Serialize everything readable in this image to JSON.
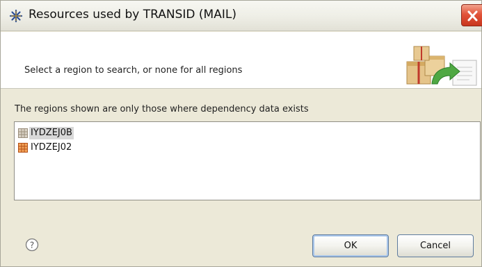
{
  "window": {
    "title": "Resources used by  TRANSID (MAIL)"
  },
  "banner": {
    "instruction": "Select a region to search, or none for all regions"
  },
  "regions": {
    "label": "The regions shown are only those where dependency data exists",
    "items": [
      {
        "label": "IYDZEJ0B",
        "selected": true
      },
      {
        "label": "IYDZEJ02",
        "selected": false
      }
    ]
  },
  "buttons": {
    "ok_label": "OK",
    "cancel_label": "Cancel"
  },
  "icons": {
    "app": "cics-asterisk-icon",
    "close": "close-icon",
    "banner": "package-resources-graphic",
    "region": "region-grid-icon",
    "help": "help-icon"
  },
  "colors": {
    "selection": "#d8d8d8",
    "close_button": "#e2543a",
    "default_button_ring": "#a9c6ea"
  }
}
